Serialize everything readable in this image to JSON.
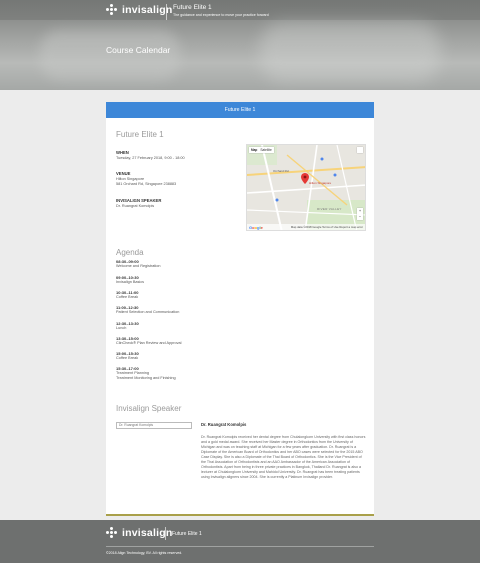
{
  "header": {
    "brand": "invisalign",
    "title": "Future Elite 1",
    "tagline": "The guidance and experience to move your practice forward",
    "page_title": "Course Calendar"
  },
  "course": {
    "bar_title": "Future Elite 1",
    "title": "Future Elite 1",
    "when_label": "WHEN",
    "when_value": "Tuesday, 27 February 2018, 9:00 - 18:00",
    "venue_label": "VENUE",
    "venue_line1": "Hilton Singapore",
    "venue_line2": "581 Orchard Rd, Singapore 238883",
    "speaker_label": "INVISALIGN SPEAKER",
    "speaker_value": "Dr. Ruangrat Komolpis"
  },
  "map": {
    "map_tab": "Map",
    "satellite_tab": "Satellite",
    "footer_text": "Map data ©2018 Google   Terms of Use   Report a map error",
    "logo": "Google",
    "labels": [
      "Orchard Rd",
      "Hilton Singapore",
      "RIVER VALLEY"
    ]
  },
  "agenda": {
    "title": "Agenda",
    "items": [
      {
        "time": "08:30–09:00",
        "desc": "Welcome and Registration"
      },
      {
        "time": "09:00–10:30",
        "desc": "Invisalign Basics"
      },
      {
        "time": "10:30–11:00",
        "desc": "Coffee Break"
      },
      {
        "time": "11:00–12:30",
        "desc": "Patient Selection and Communication"
      },
      {
        "time": "12:30–13:30",
        "desc": "Lunch"
      },
      {
        "time": "13:30–15:00",
        "desc": "ClinCheck® Plan Review and Approval"
      },
      {
        "time": "15:00–15:30",
        "desc": "Coffee Break"
      },
      {
        "time": "15:30–17:00",
        "desc": "Treatment Planning"
      },
      {
        "time": "",
        "desc": "Treatment Monitoring and Finishing"
      }
    ]
  },
  "speaker": {
    "section_title": "Invisalign Speaker",
    "image_alt": "Dr. Ruangrat Komolpis",
    "name": "Dr. Ruangrat Komolpis",
    "bio": "Dr. Ruangrat Komolpis received her dental degree from Chulalongkorn University with first class honors and a gold medal award. She received her Master degree in Orthodontics from the University of Michigan and was on teaching staff at Michigan for a few years after graduation. Dr. Ruangrat is a Diplomate of the American Board of Orthodontics and her ABO cases were selected for the 2015 ABO Case Display. She is also a Diplomate of the Thai Board of Orthodontics. She is the Vice President of the Thai Association of Orthodontists and an AAO Ambassador of the American Association of Orthodontists. Apart from being in three private practices in Bangkok, Thailand Dr. Ruangrat is also a lecturer at Chulalongkorn University and Mahidol University. Dr. Ruangrat has been treating patients using Invisalign aligners since 2004. She is currently a Platinum Invisalign provider."
  },
  "footer": {
    "brand": "invisalign",
    "title": "Future Elite 1",
    "copyright": "©2018 Align Technology, BV. All rights reserved."
  },
  "colors": {
    "accent_bar": "#3d87d8",
    "card_bottom": "#a9a04a",
    "footer_bg": "#6e706f"
  }
}
